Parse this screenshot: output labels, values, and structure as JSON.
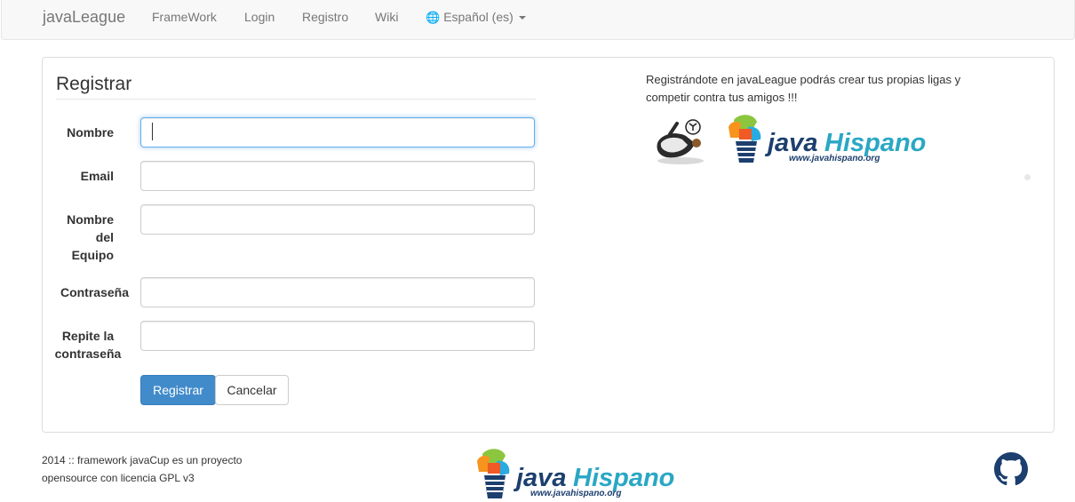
{
  "navbar": {
    "brand": "javaLeague",
    "links": [
      "FrameWork",
      "Login",
      "Registro",
      "Wiki"
    ],
    "language": "Español (es)"
  },
  "form": {
    "title": "Registrar",
    "fields": [
      {
        "label": "Nombre",
        "value": ""
      },
      {
        "label": "Email",
        "value": ""
      },
      {
        "label": "Nombre del Equipo",
        "value": ""
      },
      {
        "label": "Contraseña",
        "value": ""
      },
      {
        "label": "Repite la contraseña",
        "value": ""
      }
    ],
    "submit_label": "Registrar",
    "cancel_label": "Cancelar"
  },
  "promo": {
    "text": "Registrándote en javaLeague podrás crear tus propias ligas y competir contra tus amigos !!!"
  },
  "logo": {
    "java": "java",
    "hispano": "Hispano",
    "url": "www.javahispano.org"
  },
  "footer": {
    "text": "2014 :: framework javaCup es un proyecto opensource con licencia GPL v3"
  },
  "colors": {
    "primary": "#428bca",
    "logo_dark": "#1c3f6e",
    "logo_teal": "#2aa7c4"
  }
}
